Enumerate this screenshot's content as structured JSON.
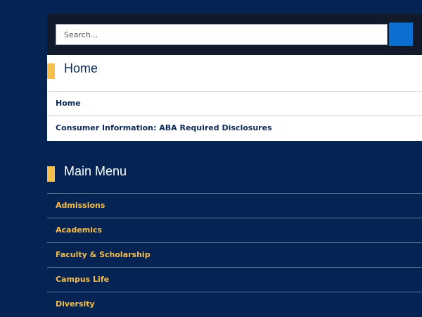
{
  "search": {
    "placeholder": "Search..."
  },
  "breadcrumb_block": {
    "title": "Home",
    "links": [
      {
        "label": "Home"
      },
      {
        "label": "Consumer Information: ABA Required Disclosures"
      }
    ]
  },
  "main_menu": {
    "title": "Main Menu",
    "items": [
      {
        "label": "Admissions"
      },
      {
        "label": "Academics"
      },
      {
        "label": "Faculty & Scholarship"
      },
      {
        "label": "Campus Life"
      },
      {
        "label": "Diversity"
      }
    ]
  },
  "colors": {
    "background": "#052453",
    "accent": "#f6be4d",
    "search_button": "#0a6fd0",
    "search_bar": "#111a2b"
  }
}
